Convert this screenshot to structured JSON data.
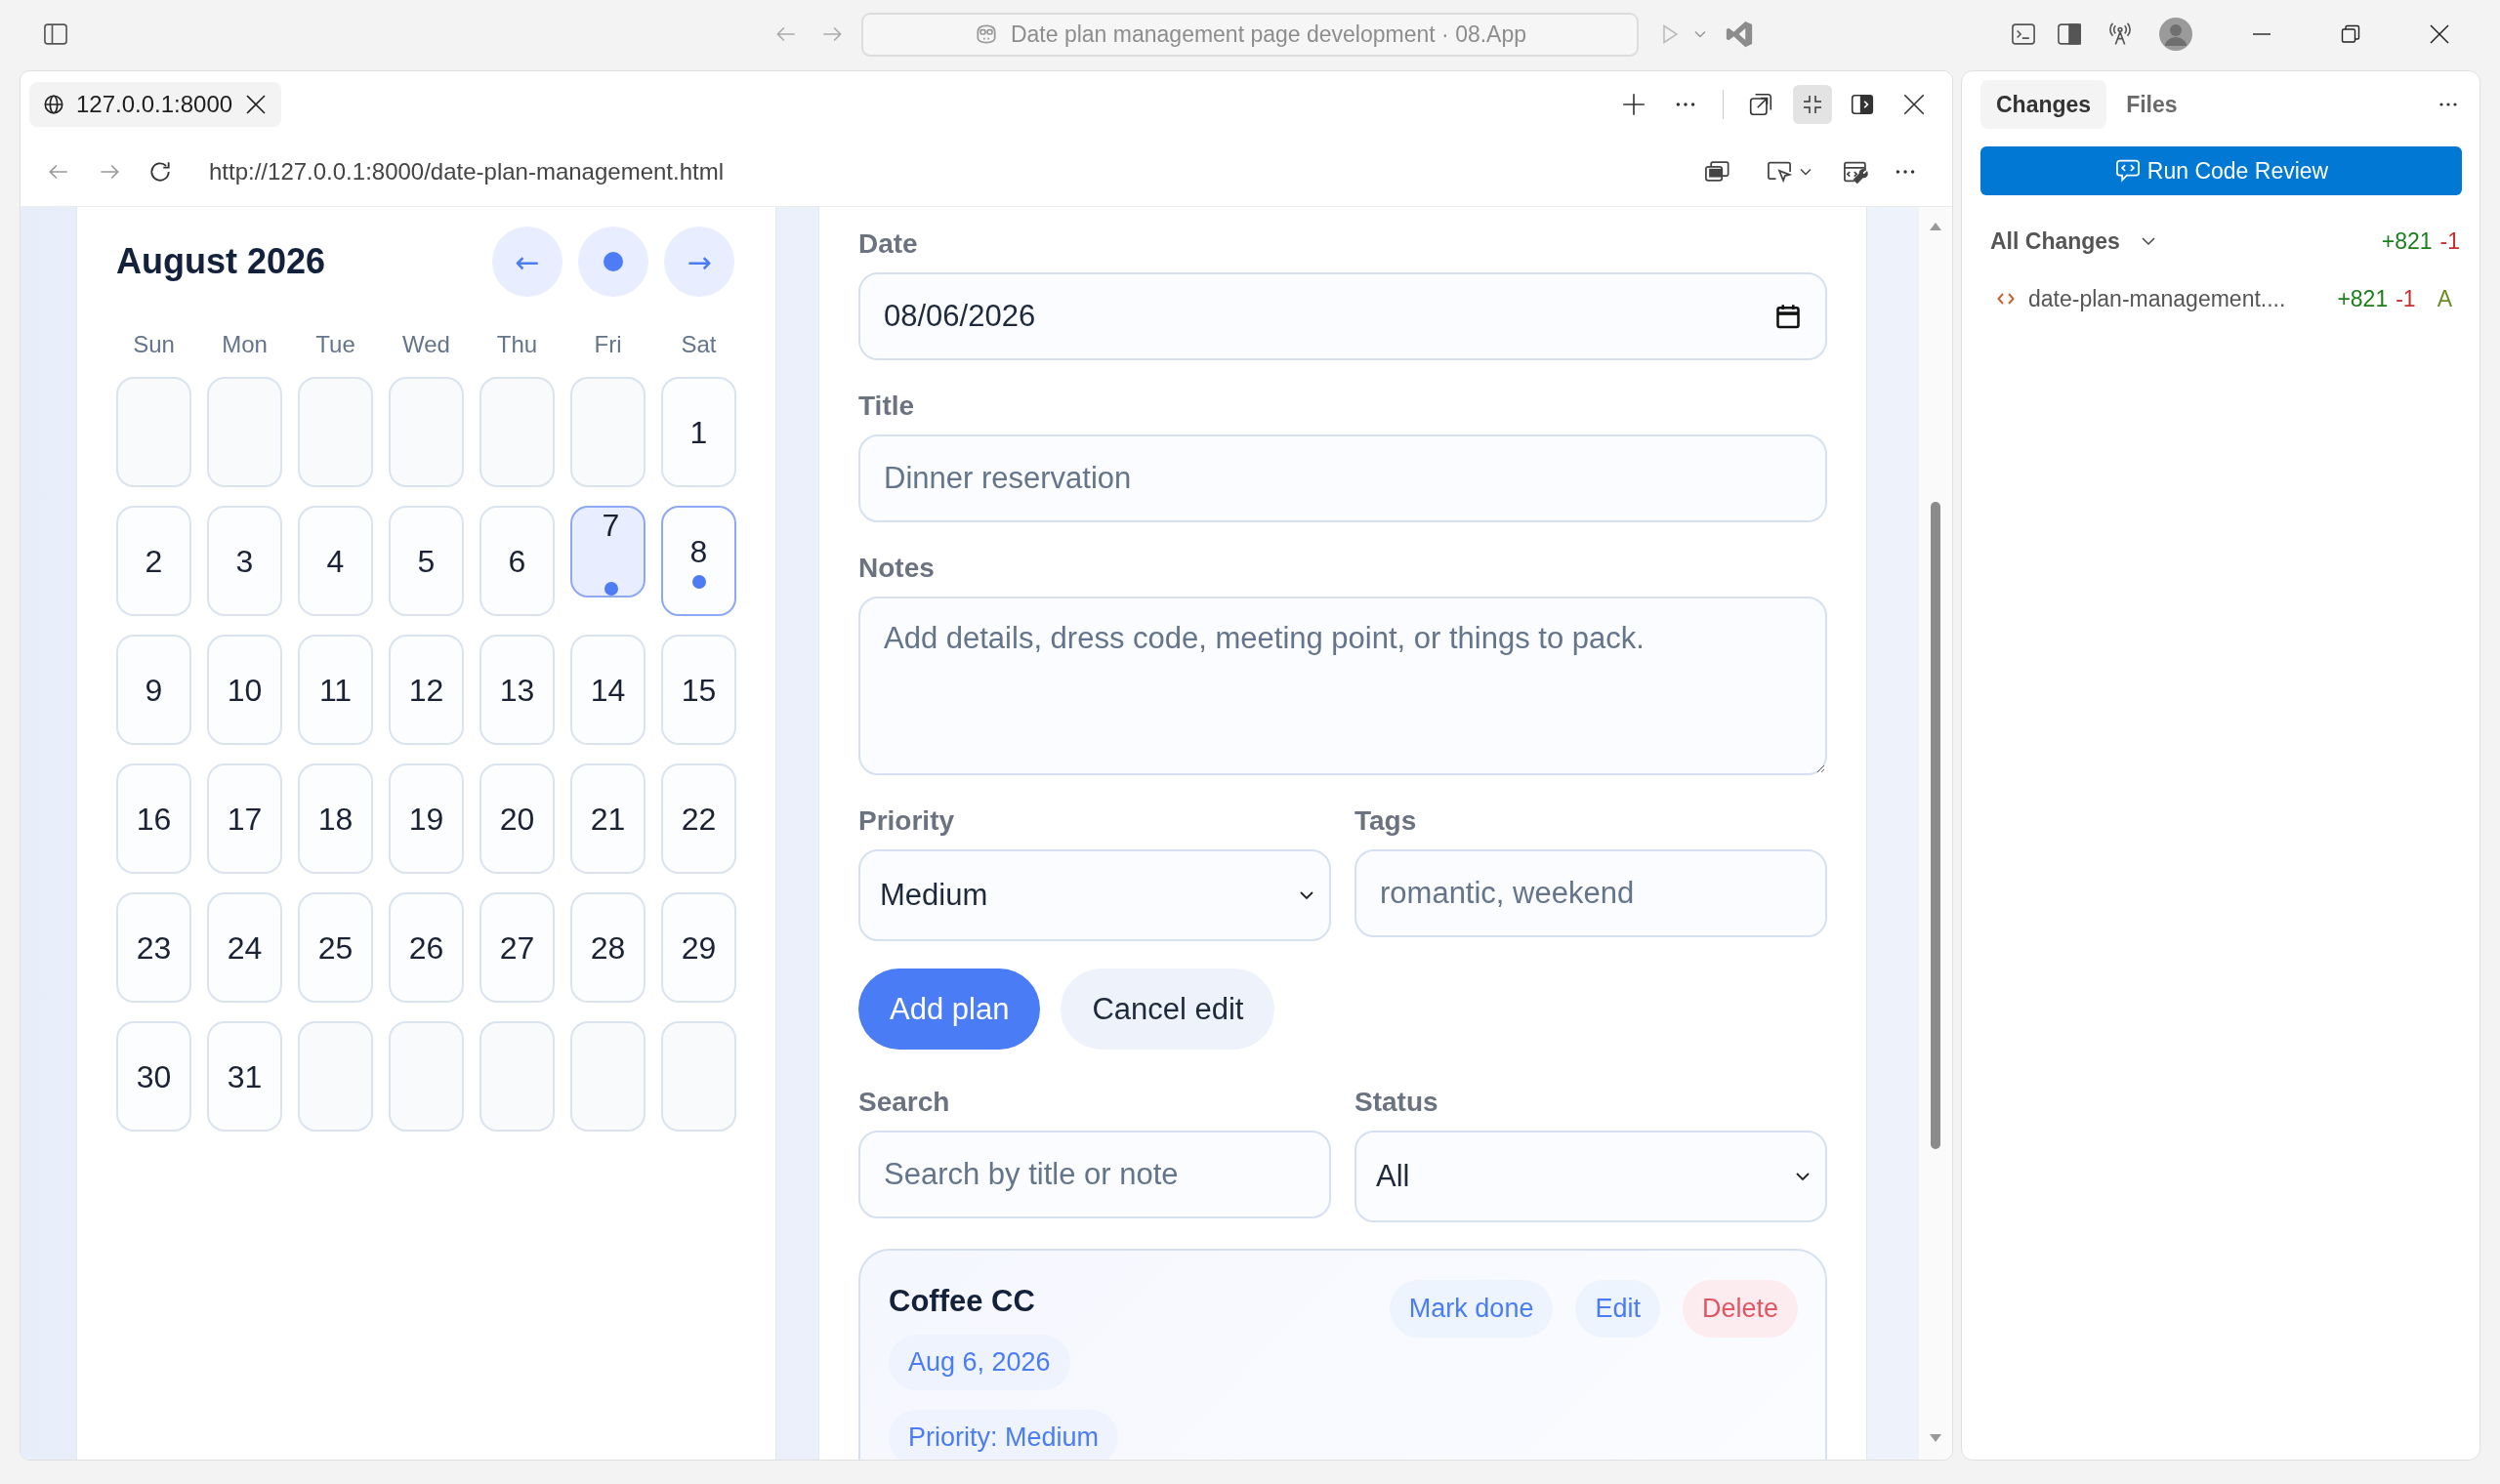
{
  "window": {
    "command_center": "Date plan management page development · 08.App"
  },
  "browser": {
    "tab": {
      "title": "127.0.0.1:8000"
    },
    "address": "http://127.0.0.1:8000/date-plan-management.html"
  },
  "calendar": {
    "title": "August 2026",
    "nav": [
      {
        "kind": "prev",
        "label": "←"
      },
      {
        "kind": "today"
      },
      {
        "kind": "next",
        "label": "→"
      }
    ],
    "weekdays": [
      "Sun",
      "Mon",
      "Tue",
      "Wed",
      "Thu",
      "Fri",
      "Sat"
    ],
    "weeks": [
      [
        {
          "kind": "blank"
        },
        {
          "kind": "blank"
        },
        {
          "kind": "blank"
        },
        {
          "kind": "blank"
        },
        {
          "kind": "blank"
        },
        {
          "kind": "blank"
        },
        {
          "kind": "day",
          "label": "1",
          "selected": false,
          "today": false,
          "has_plans": false
        }
      ],
      [
        {
          "kind": "day",
          "label": "2",
          "selected": false,
          "today": false,
          "has_plans": false
        },
        {
          "kind": "day",
          "label": "3",
          "selected": false,
          "today": false,
          "has_plans": false
        },
        {
          "kind": "day",
          "label": "4",
          "selected": false,
          "today": false,
          "has_plans": false
        },
        {
          "kind": "day",
          "label": "5",
          "selected": false,
          "today": false,
          "has_plans": false
        },
        {
          "kind": "day",
          "label": "6",
          "selected": false,
          "today": false,
          "has_plans": false
        },
        {
          "kind": "day",
          "label": "7",
          "selected": true,
          "today": false,
          "has_plans": true
        },
        {
          "kind": "day",
          "label": "8",
          "selected": false,
          "today": true,
          "has_plans": true
        }
      ],
      [
        {
          "kind": "day",
          "label": "9",
          "selected": false,
          "today": false,
          "has_plans": false
        },
        {
          "kind": "day",
          "label": "10",
          "selected": false,
          "today": false,
          "has_plans": false
        },
        {
          "kind": "day",
          "label": "11",
          "selected": false,
          "today": false,
          "has_plans": false
        },
        {
          "kind": "day",
          "label": "12",
          "selected": false,
          "today": false,
          "has_plans": false
        },
        {
          "kind": "day",
          "label": "13",
          "selected": false,
          "today": false,
          "has_plans": false
        },
        {
          "kind": "day",
          "label": "14",
          "selected": false,
          "today": false,
          "has_plans": false
        },
        {
          "kind": "day",
          "label": "15",
          "selected": false,
          "today": false,
          "has_plans": false
        }
      ],
      [
        {
          "kind": "day",
          "label": "16",
          "selected": false,
          "today": false,
          "has_plans": false
        },
        {
          "kind": "day",
          "label": "17",
          "selected": false,
          "today": false,
          "has_plans": false
        },
        {
          "kind": "day",
          "label": "18",
          "selected": false,
          "today": false,
          "has_plans": false
        },
        {
          "kind": "day",
          "label": "19",
          "selected": false,
          "today": false,
          "has_plans": false
        },
        {
          "kind": "day",
          "label": "20",
          "selected": false,
          "today": false,
          "has_plans": false
        },
        {
          "kind": "day",
          "label": "21",
          "selected": false,
          "today": false,
          "has_plans": false
        },
        {
          "kind": "day",
          "label": "22",
          "selected": false,
          "today": false,
          "has_plans": false
        }
      ],
      [
        {
          "kind": "day",
          "label": "23",
          "selected": false,
          "today": false,
          "has_plans": false
        },
        {
          "kind": "day",
          "label": "24",
          "selected": false,
          "today": false,
          "has_plans": false
        },
        {
          "kind": "day",
          "label": "25",
          "selected": false,
          "today": false,
          "has_plans": false
        },
        {
          "kind": "day",
          "label": "26",
          "selected": false,
          "today": false,
          "has_plans": false
        },
        {
          "kind": "day",
          "label": "27",
          "selected": false,
          "today": false,
          "has_plans": false
        },
        {
          "kind": "day",
          "label": "28",
          "selected": false,
          "today": false,
          "has_plans": false
        },
        {
          "kind": "day",
          "label": "29",
          "selected": false,
          "today": false,
          "has_plans": false
        }
      ],
      [
        {
          "kind": "day",
          "label": "30",
          "selected": false,
          "today": false,
          "has_plans": false
        },
        {
          "kind": "day",
          "label": "31",
          "selected": false,
          "today": false,
          "has_plans": false
        },
        {
          "kind": "blank"
        },
        {
          "kind": "blank"
        },
        {
          "kind": "blank"
        },
        {
          "kind": "blank"
        },
        {
          "kind": "blank"
        }
      ]
    ]
  },
  "plan_form": {
    "date": {
      "label": "Date",
      "value": "08/06/2026"
    },
    "title": {
      "label": "Title",
      "placeholder": "Dinner reservation"
    },
    "notes": {
      "label": "Notes",
      "placeholder": "Add details, dress code, meeting point, or things to pack."
    },
    "priority": {
      "label": "Priority",
      "value": "Medium"
    },
    "tags": {
      "label": "Tags",
      "placeholder": "romantic, weekend"
    },
    "buttons": [
      {
        "kind": "submit",
        "label": "Add plan"
      },
      {
        "kind": "cancel",
        "label": "Cancel edit"
      }
    ]
  },
  "filters": {
    "search": {
      "label": "Search",
      "placeholder": "Search by title or note"
    },
    "status": {
      "label": "Status",
      "value": "All"
    }
  },
  "plans": [
    {
      "title": "Coffee CC",
      "date": "Aug 6, 2026",
      "priority": "Priority: Medium",
      "actions": [
        {
          "kind": "complete",
          "label": "Mark done"
        },
        {
          "kind": "edit",
          "label": "Edit"
        },
        {
          "kind": "delete",
          "label": "Delete"
        }
      ]
    }
  ],
  "changes_panel": {
    "tabs": [
      {
        "label": "Changes",
        "selected": true
      },
      {
        "label": "Files",
        "selected": false
      }
    ],
    "review_button": "Run Code Review",
    "group": {
      "label": "All Changes",
      "expanded": true,
      "added": "+821",
      "removed": "-1"
    },
    "files": [
      {
        "name": "date-plan-management....",
        "added": "+821",
        "removed": "-1",
        "status": "A"
      }
    ]
  }
}
